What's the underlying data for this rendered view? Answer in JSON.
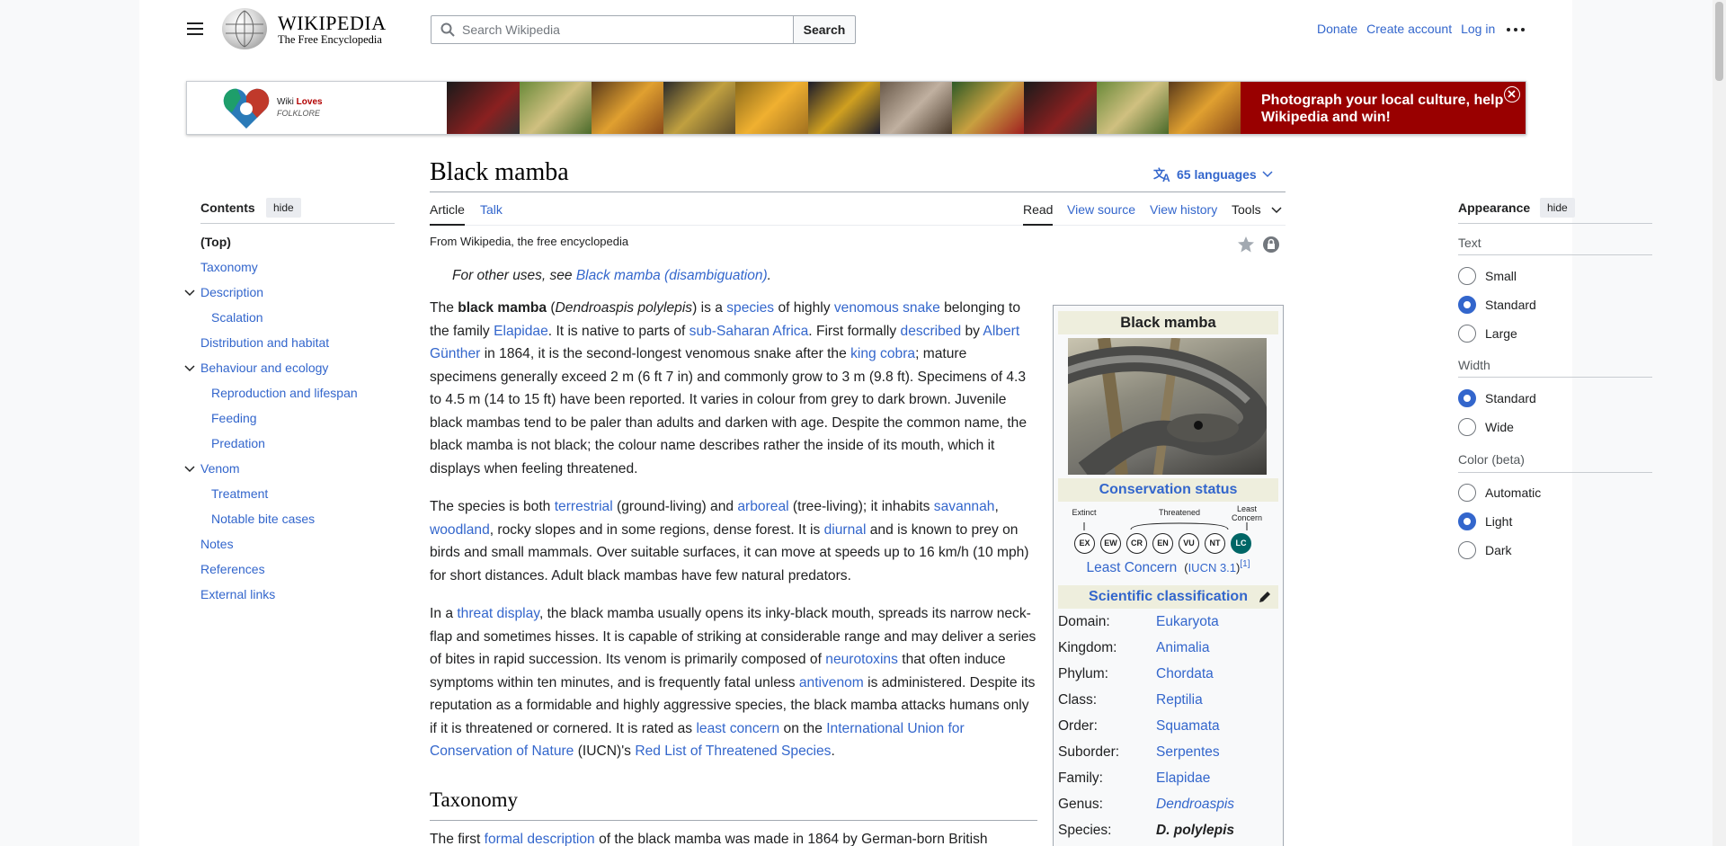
{
  "header": {
    "wordmark_title": "Wikipedia",
    "wordmark_subtitle": "The Free Encyclopedia",
    "search_placeholder": "Search Wikipedia",
    "search_button": "Search",
    "links": [
      "Donate",
      "Create account",
      "Log in"
    ]
  },
  "banner": {
    "logo_text_1": "Wiki",
    "logo_text_2": "Loves",
    "logo_text_3": "FOLKLORE",
    "cta": "Photograph your local culture, help Wikipedia and win!"
  },
  "toc": {
    "title": "Contents",
    "hide": "hide",
    "items": [
      "(Top)",
      "Taxonomy",
      "Description",
      "Scalation",
      "Distribution and habitat",
      "Behaviour and ecology",
      "Reproduction and lifespan",
      "Feeding",
      "Predation",
      "Venom",
      "Treatment",
      "Notable bite cases",
      "Notes",
      "References",
      "External links"
    ]
  },
  "article": {
    "title": "Black mamba",
    "languages": "65 languages",
    "tabs_left": [
      "Article",
      "Talk"
    ],
    "tabs_right": [
      "Read",
      "View source",
      "View history",
      "Tools"
    ],
    "from": "From Wikipedia, the free encyclopedia",
    "hatnote_prefix": "For other uses, see ",
    "hatnote_link": "Black mamba (disambiguation)",
    "hatnote_suffix": ".",
    "section_taxonomy": "Taxonomy",
    "p1": {
      "a": "The ",
      "b": "black mamba",
      "c": " (",
      "d": "Dendroaspis polylepis",
      "e": ") is a ",
      "f": "species",
      "g": " of highly ",
      "h": "venomous snake",
      "i": " belonging to the family ",
      "j": "Elapidae",
      "k": ". It is native to parts of ",
      "l": "sub-Saharan Africa",
      "m": ". First formally ",
      "n": "described",
      "o": " by ",
      "p": "Albert Günther",
      "q": " in 1864, it is the second-longest venomous snake after the ",
      "r": "king cobra",
      "s": "; mature specimens generally exceed 2 m (6 ft 7 in) and commonly grow to 3 m (9.8 ft). Specimens of 4.3 to 4.5 m (14 to 15 ft) have been reported. It varies in colour from grey to dark brown. Juvenile black mambas tend to be paler than adults and darken with age. Despite the common name, the black mamba is not black; the colour name describes rather the inside of its mouth, which it displays when feeling threatened."
    },
    "p2": {
      "a": "The species is both ",
      "b": "terrestrial",
      "c": " (ground-living) and ",
      "d": "arboreal",
      "e": " (tree-living); it inhabits ",
      "f": "savannah",
      "g": ", ",
      "h": "woodland",
      "i": ", rocky slopes and in some regions, dense forest. It is ",
      "j": "diurnal",
      "k": " and is known to prey on birds and small mammals. Over suitable surfaces, it can move at speeds up to 16 km/h (10 mph) for short distances. Adult black mambas have few natural predators."
    },
    "p3": {
      "a": "In a ",
      "b": "threat display",
      "c": ", the black mamba usually opens its inky-black mouth, spreads its narrow neck-flap and sometimes hisses. It is capable of striking at considerable range and may deliver a series of bites in rapid succession. Its venom is primarily composed of ",
      "d": "neurotoxins",
      "e": " that often induce symptoms within ten minutes, and is frequently fatal unless ",
      "f": "antivenom",
      "g": " is administered. Despite its reputation as a formidable and highly aggressive species, the black mamba attacks humans only if it is threatened or cornered. It is rated as ",
      "h": "least concern",
      "i": " on the ",
      "j": "International Union for Conservation of Nature",
      "k": " (IUCN)'s ",
      "l": "Red List of Threatened Species",
      "m": "."
    },
    "p4": {
      "a": "The first ",
      "b": "formal description",
      "c": " of the black mamba was made in 1864 by German-born British"
    }
  },
  "infobox": {
    "title": "Black mamba",
    "conservation_heading": "Conservation status",
    "scale_labels": {
      "extinct": "Extinct",
      "threatened": "Threatened",
      "least": "Least Concern"
    },
    "scale_codes": [
      "EX",
      "EW",
      "CR",
      "EN",
      "VU",
      "NT",
      "LC"
    ],
    "status": "Least Concern",
    "status_source": "IUCN 3.1",
    "status_ref": "[1]",
    "classification_heading": "Scientific classification",
    "rows": [
      {
        "k": "Domain:",
        "v": "Eukaryota"
      },
      {
        "k": "Kingdom:",
        "v": "Animalia"
      },
      {
        "k": "Phylum:",
        "v": "Chordata"
      },
      {
        "k": "Class:",
        "v": "Reptilia"
      },
      {
        "k": "Order:",
        "v": "Squamata"
      },
      {
        "k": "Suborder:",
        "v": "Serpentes"
      },
      {
        "k": "Family:",
        "v": "Elapidae"
      },
      {
        "k": "Genus:",
        "v": "Dendroaspis"
      },
      {
        "k": "Species:",
        "v": "D. polylepis"
      }
    ]
  },
  "appearance": {
    "title": "Appearance",
    "hide": "hide",
    "text_label": "Text",
    "text_options": [
      "Small",
      "Standard",
      "Large"
    ],
    "text_selected": "Standard",
    "width_label": "Width",
    "width_options": [
      "Standard",
      "Wide"
    ],
    "width_selected": "Standard",
    "color_label": "Color (beta)",
    "color_options": [
      "Automatic",
      "Light",
      "Dark"
    ],
    "color_selected": "Light"
  },
  "colors": {
    "link": "#3366cc",
    "banner_red": "#990000",
    "lc_green": "#006666"
  }
}
